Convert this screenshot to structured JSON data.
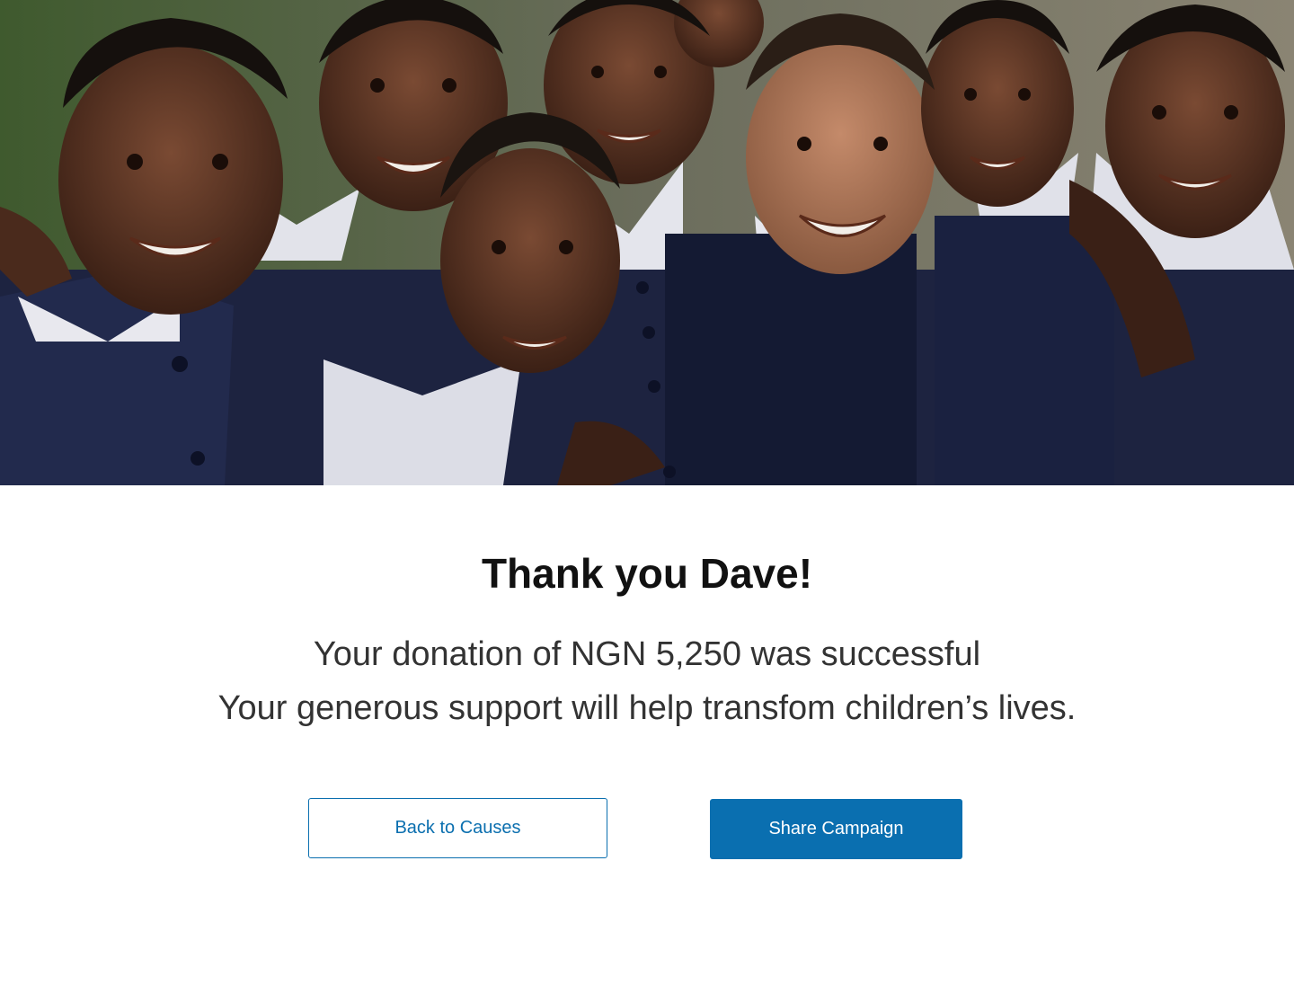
{
  "hero": {
    "image_description": "children-in-school-uniforms"
  },
  "confirmation": {
    "title": "Thank you Dave!",
    "line1": "Your donation of NGN 5,250 was successful",
    "line2": "Your generous support will help transfom children’s lives."
  },
  "actions": {
    "back_label": "Back to Causes",
    "share_label": "Share Campaign"
  },
  "colors": {
    "accent": "#0a6fb0",
    "title": "#111111",
    "body_text": "#333333",
    "background": "#ffffff"
  }
}
